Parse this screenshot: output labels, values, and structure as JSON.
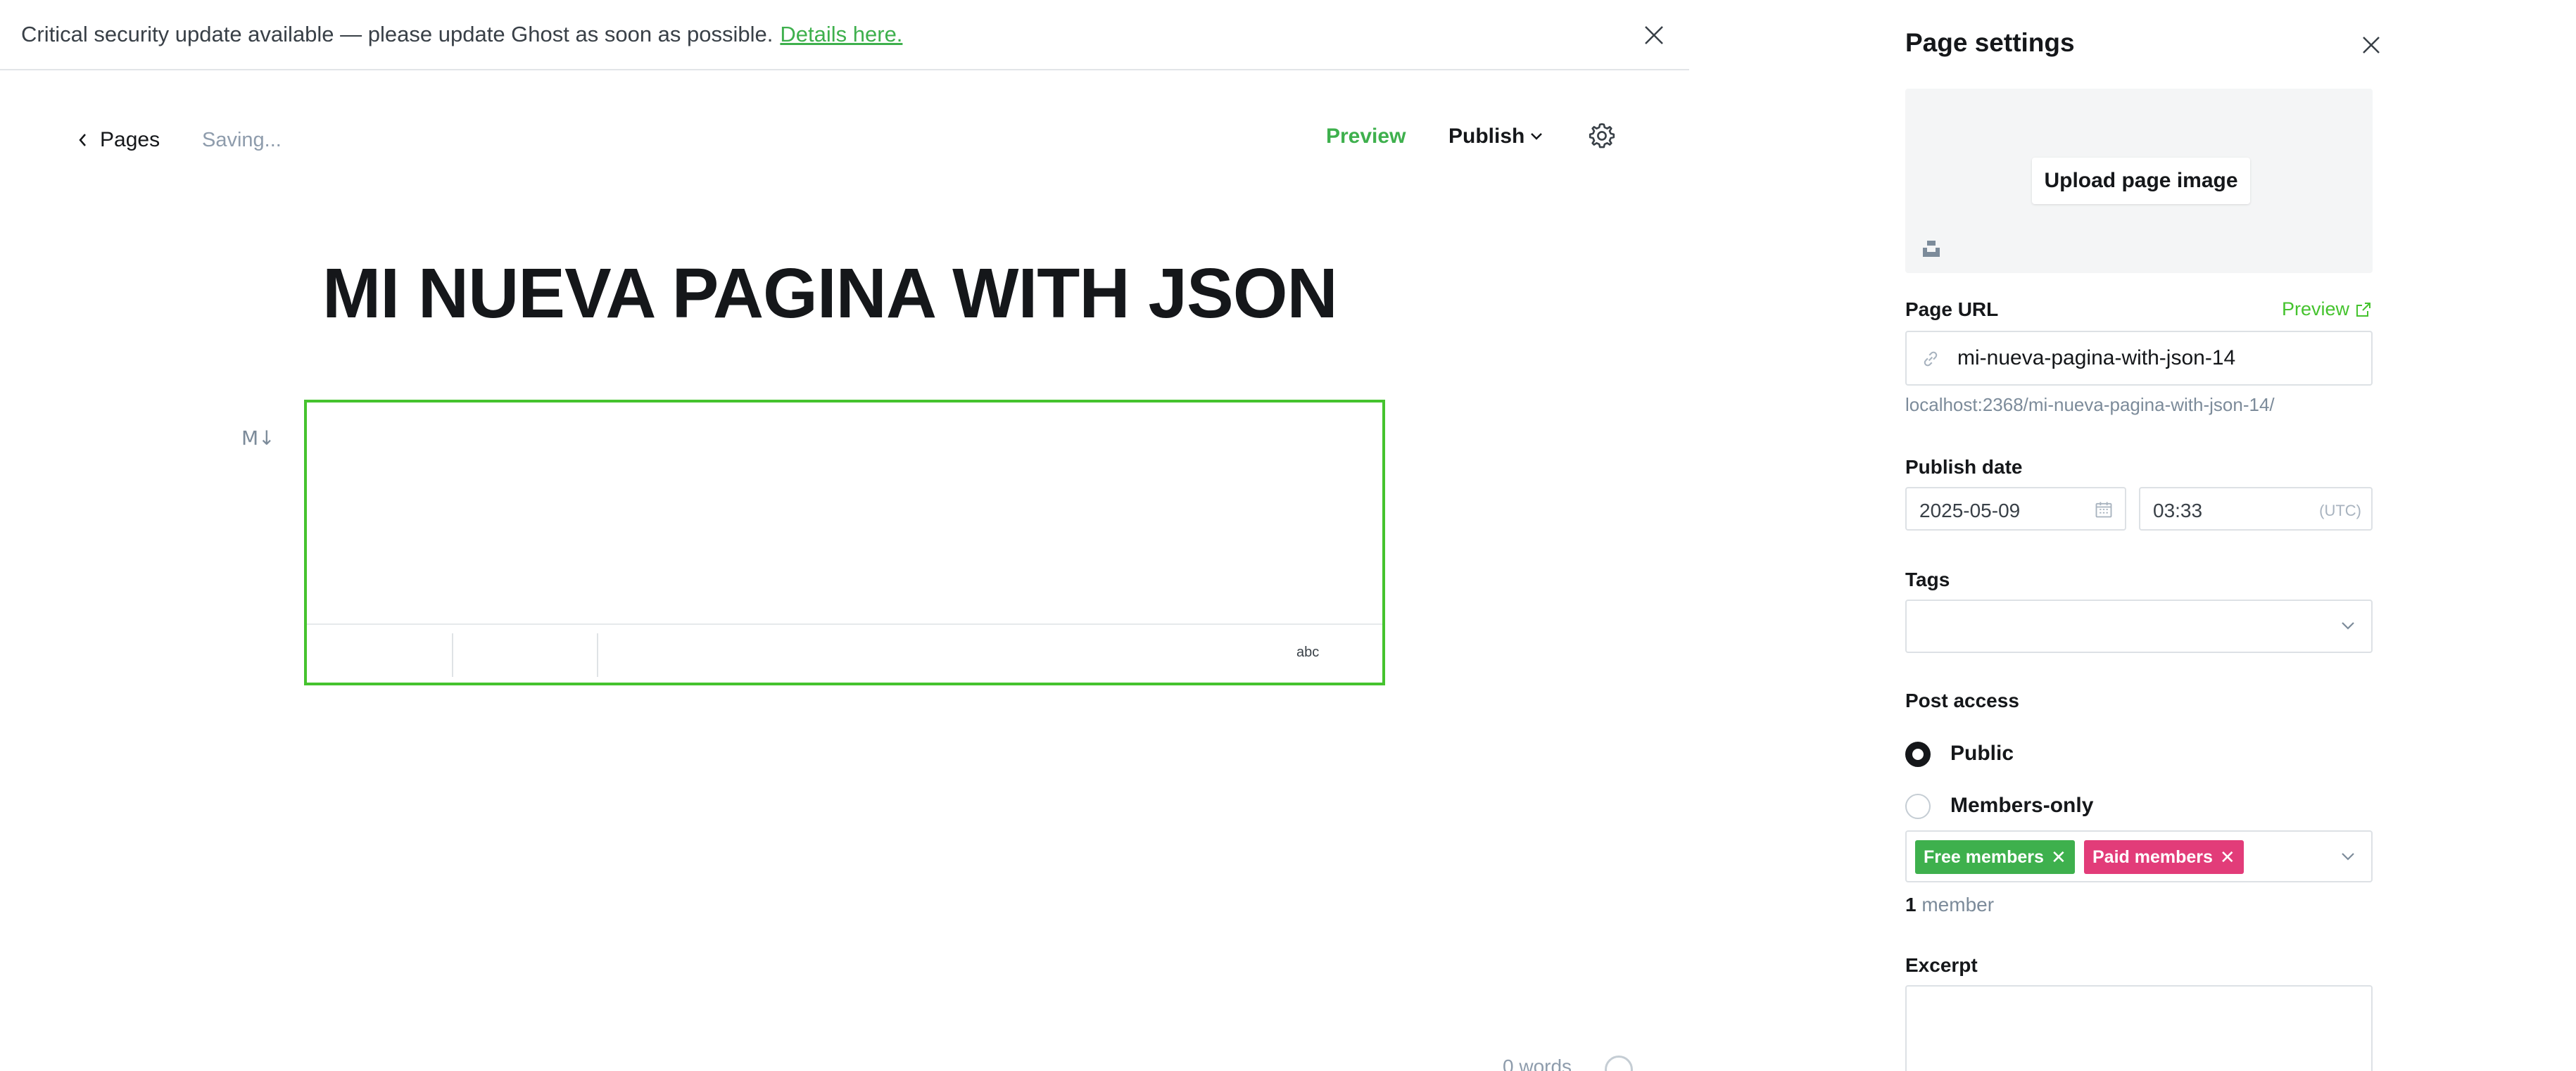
{
  "alert": {
    "message": "Critical security update available — please update Ghost as soon as possible.",
    "link_label": "Details here."
  },
  "editor": {
    "back_label": "Pages",
    "status": "Saving...",
    "preview_label": "Preview",
    "publish_label": "Publish",
    "title": "MI NUEVA PAGINA WITH JSON",
    "markdown_icon": "M↓",
    "spellcheck_label": "abc",
    "word_count": "0 words"
  },
  "settings": {
    "title": "Page settings",
    "upload_image_label": "Upload page image",
    "page_url_label": "Page URL",
    "page_url_preview": "Preview",
    "page_url_value": "mi-nueva-pagina-with-json-14",
    "page_url_hint": "localhost:2368/mi-nueva-pagina-with-json-14/",
    "publish_date_label": "Publish date",
    "publish_date": "2025-05-09",
    "publish_time": "03:33",
    "timezone": "(UTC)",
    "tags_label": "Tags",
    "post_access_label": "Post access",
    "access_options": [
      {
        "label": "Public",
        "selected": true
      },
      {
        "label": "Members-only",
        "selected": false
      }
    ],
    "segments": [
      {
        "label": "Free members",
        "color": "#3eb04d"
      },
      {
        "label": "Paid members",
        "color": "#e23c79"
      }
    ],
    "member_count_number": "1",
    "member_count_suffix": "member",
    "excerpt_label": "Excerpt"
  },
  "colors": {
    "accent_green": "#3eb04d",
    "editor_border": "#45c32e",
    "paid_pink": "#e23c79"
  }
}
